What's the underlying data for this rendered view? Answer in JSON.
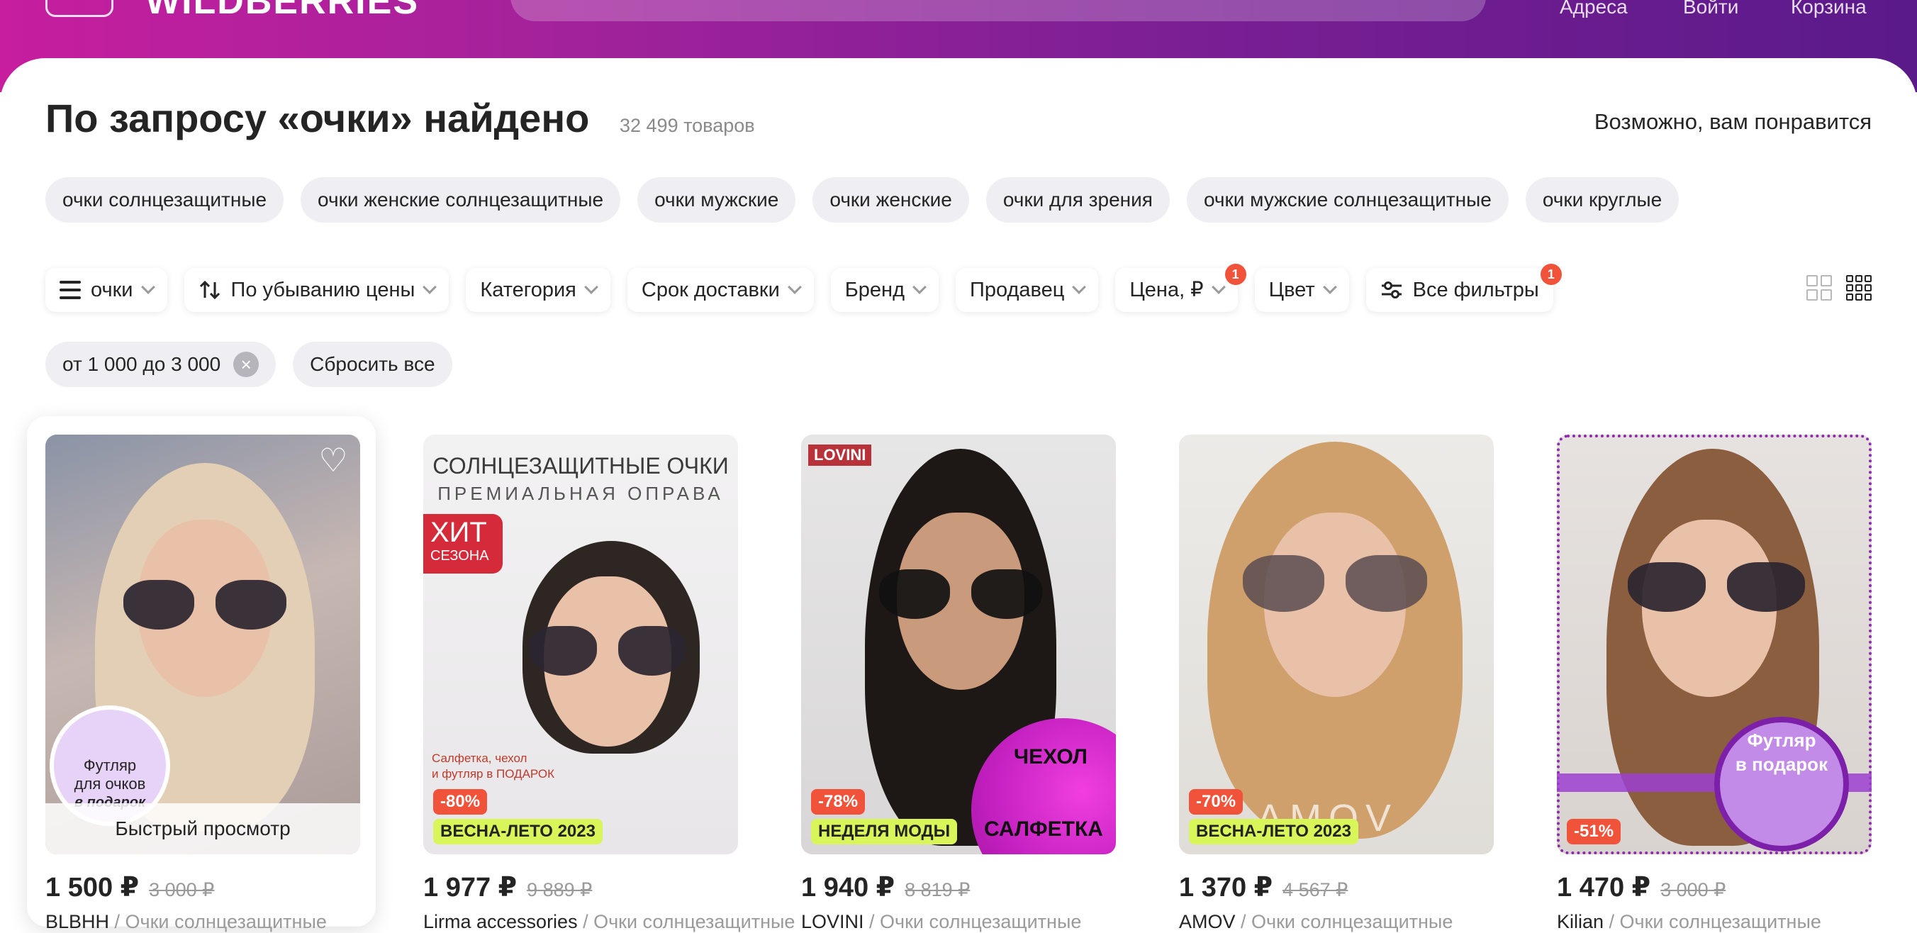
{
  "header": {
    "logo_text": "WILDBERRIES",
    "links": [
      "Адреса",
      "Войти",
      "Корзина"
    ]
  },
  "search_results": {
    "title": "По запросу «очки» найдено",
    "count": "32 499 товаров",
    "side_title": "Возможно, вам понравится"
  },
  "suggestions": [
    "очки солнцезащитные",
    "очки женские солнцезащитные",
    "очки мужские",
    "очки женские",
    "очки для зрения",
    "очки мужские солнцезащитные",
    "очки круглые"
  ],
  "filters": {
    "query": "очки",
    "sort": "По убыванию цены",
    "category": "Категория",
    "delivery": "Срок доставки",
    "brand": "Бренд",
    "seller": "Продавец",
    "price": "Цена, ₽",
    "price_badge": "1",
    "color": "Цвет",
    "all_filters": "Все фильтры",
    "all_filters_badge": "1"
  },
  "applied": {
    "price_range": "от 1 000 до 3 000",
    "reset": "Сбросить все"
  },
  "products": [
    {
      "price": "1 500 ₽",
      "old_price": "3 000 ₽",
      "brand": "BLBHH",
      "name": " / Очки солнцезащитные",
      "quick_view": "Быстрый просмотр",
      "gift_line1": "Футляр",
      "gift_line2": "для очков",
      "gift_line3": "в подарок"
    },
    {
      "price": "1 977 ₽",
      "old_price": "9 889 ₽",
      "brand": "Lirma accessories",
      "name": " / Очки солнцезащитные",
      "discount": "-80%",
      "promo": "ВЕСНА-ЛЕТО 2023",
      "headline1": "СОЛНЦЕЗАЩИТНЫЕ ОЧКИ",
      "headline2": "ПРЕМИАЛЬНАЯ ОПРАВА",
      "hit1": "ХИТ",
      "hit2": "СЕЗОНА",
      "note1": "Салфетка, чехол",
      "note2": "и футляр в ПОДАРОК"
    },
    {
      "price": "1 940 ₽",
      "old_price": "8 819 ₽",
      "brand": "LOVINI",
      "name": " / Очки солнцезащитные",
      "discount": "-78%",
      "promo": "НЕДЕЛЯ МОДЫ",
      "logo": "LOVINI",
      "extra1": "ЧЕХОЛ",
      "extra2": "САЛФЕТКА"
    },
    {
      "price": "1 370 ₽",
      "old_price": "4 567 ₽",
      "brand": "AMOV",
      "name": " / Очки солнцезащитные",
      "discount": "-70%",
      "promo": "ВЕСНА-ЛЕТО 2023",
      "watermark": "AMOV"
    },
    {
      "price": "1 470 ₽",
      "old_price": "3 000 ₽",
      "brand": "Kilian",
      "name": " / Очки солнцезащитные",
      "discount": "-51%",
      "gift_line1": "Футляр",
      "gift_line2": "в подарок"
    }
  ],
  "colors": {
    "accent_start": "#c61e9e",
    "accent_end": "#5a1a8a",
    "discount": "#f0523a",
    "promo": "#d8f55a"
  }
}
